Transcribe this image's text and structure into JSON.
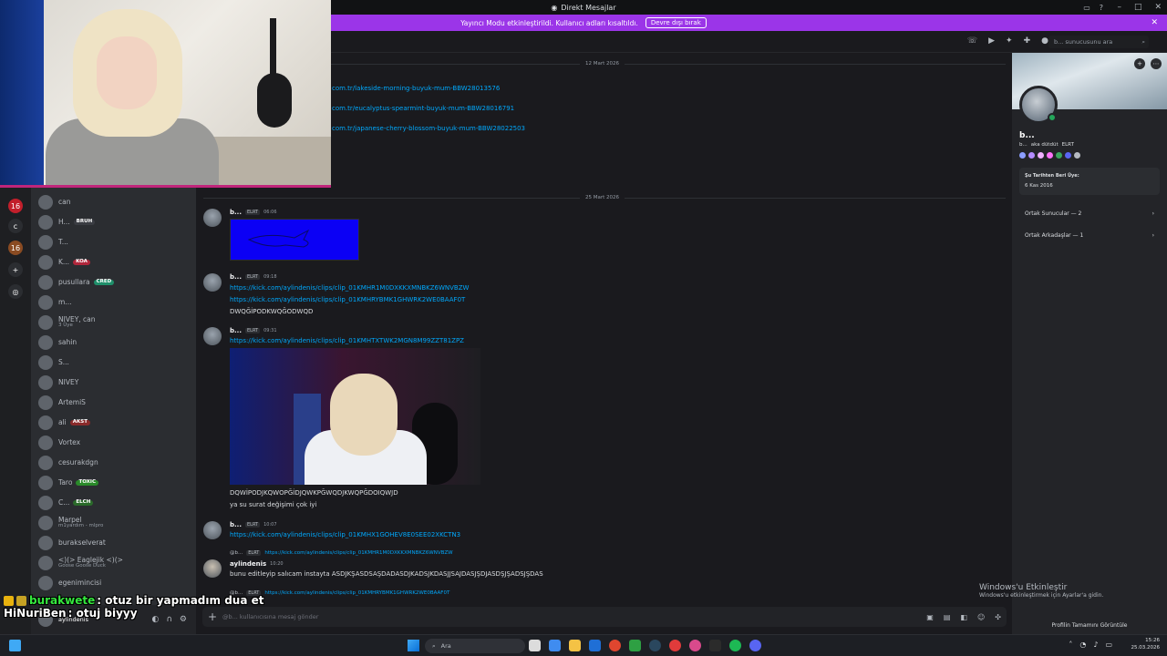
{
  "window": {
    "title": "Direkt Mesajlar"
  },
  "banner": {
    "text": "Yayıncı Modu etkinleştirildi. Kullanıcı adları kısaltıldı.",
    "button": "Devre dışı bırak"
  },
  "header": {
    "search_placeholder": "b... sunucusunu ara"
  },
  "rail": {
    "badge1": "16",
    "badge2": "16"
  },
  "dm_list": [
    {
      "name": "can",
      "sub": "",
      "tag": ""
    },
    {
      "name": "H...",
      "sub": "",
      "tag": "BRUH",
      "tag_color": "#3a3c42"
    },
    {
      "name": "T...",
      "sub": "",
      "tag": ""
    },
    {
      "name": "K...",
      "sub": "",
      "tag": "KOA",
      "tag_color": "#b0263b"
    },
    {
      "name": "pusullara",
      "sub": "",
      "tag": "CRED",
      "tag_color": "#1f8f6a"
    },
    {
      "name": "m...",
      "sub": "",
      "tag": ""
    },
    {
      "name": "NIVEY, can",
      "sub": "3 Üye",
      "tag": ""
    },
    {
      "name": "sahin",
      "sub": "",
      "tag": ""
    },
    {
      "name": "S...",
      "sub": "",
      "tag": ""
    },
    {
      "name": "NIVEY",
      "sub": "",
      "tag": ""
    },
    {
      "name": "ArtemiS",
      "sub": "",
      "tag": ""
    },
    {
      "name": "ali",
      "sub": "",
      "tag": "AKST",
      "tag_color": "#8a2a2a"
    },
    {
      "name": "Vortex",
      "sub": "",
      "tag": ""
    },
    {
      "name": "cesurakdgn",
      "sub": "",
      "tag": ""
    },
    {
      "name": "Taro",
      "sub": "",
      "tag": "TOXIC",
      "tag_color": "#2a8a2a"
    },
    {
      "name": "C...",
      "sub": "",
      "tag": "ELCH",
      "tag_color": "#2a6a2a"
    },
    {
      "name": "Marpel",
      "sub": "m1yardım - mlpro",
      "tag": ""
    },
    {
      "name": "burakselverat",
      "sub": "",
      "tag": ""
    },
    {
      "name": "<)(> Eaglejik <)(>",
      "sub": "Goose Goose Duck",
      "tag": ""
    },
    {
      "name": "egenimincisi",
      "sub": "",
      "tag": ""
    }
  ],
  "user_panel": {
    "name": "aylindenis"
  },
  "messages": {
    "date1": "12 Mart 2026",
    "date2": "25 Mart 2026",
    "top_links": [
      "com.tr/lakeside-morning-buyuk-mum-BBW28013576",
      "com.tr/eucalyptus-spearmint-buyuk-mum-BBW28016791",
      "com.tr/japanese-cherry-blossom-buyuk-mum-BBW28022503"
    ],
    "m1": {
      "author": "b...",
      "clan": "ELRT",
      "time": "06:06"
    },
    "m2": {
      "author": "b...",
      "clan": "ELRT",
      "time": "09:18",
      "link1": "https://kick.com/aylindenis/clips/clip_01KMHR1M0DXKKXMNBKZ6WNVBZW",
      "link2": "https://kick.com/aylindenis/clips/clip_01KMHRYBMK1GHWRK2WE0BAAF0T",
      "text": "DWQĞİPODKWQĞODWQD"
    },
    "m3": {
      "author": "b...",
      "clan": "ELRT",
      "time": "09:31",
      "link": "https://kick.com/aylindenis/clips/clip_01KMHTXTWK2MGN8M99ZZT81ZPZ",
      "text1": "DQWİPODJKQWOPĞİDJQWKPĞWQDJKWQPĞDOIQWJD",
      "text2": "ya su surat değişimi çok iyi"
    },
    "m4": {
      "author": "b...",
      "clan": "ELRT",
      "time": "10:07",
      "link": "https://kick.com/aylindenis/clips/clip_01KMHX1GOHEV8E0SEE02XKCTN3"
    },
    "reply1": {
      "author": "@b...",
      "clan": "ELRT",
      "link": "https://kick.com/aylindenis/clips/clip_01KMHR1M0DXKKXMNBKZ6WNVBZW"
    },
    "m5": {
      "author": "aylindenis",
      "time": "10:20",
      "text": "bunu editleyip salıcam instayta ASDJKŞASDSAŞDADASDJKADSJKDASJJSAJDASJŞDJASDŞJŞADSJŞDAS"
    },
    "reply2": {
      "author": "@b...",
      "clan": "ELRT",
      "link": "https://kick.com/aylindenis/clips/clip_01KMHRYBMK1GHWRK2WE0BAAF0T"
    }
  },
  "composer": {
    "placeholder": "@b... kullanıcısına mesaj gönder"
  },
  "profile": {
    "name": "b...",
    "aka": "aka dütdüt",
    "clan": "ELRT",
    "member_since_title": "Şu Tarihten Beri Üye:",
    "member_since": "6 Kas 2016",
    "mutual_servers": "Ortak Sunucular — 2",
    "mutual_friends": "Ortak Arkadaşlar — 1",
    "full_profile": "Profilin Tamamını Görüntüle"
  },
  "activation": {
    "title": "Windows'u Etkinleştir",
    "sub": "Windows'u etkinleştirmek için Ayarlar'a gidin."
  },
  "overlay": {
    "line1_user": "burakwete",
    "line1_text": ": otuz bir yapmadım dua et",
    "line2_user": "HiNuriBen",
    "line2_text": ": otuj biyyy"
  },
  "taskbar": {
    "search": "Ara",
    "time": "15:26",
    "date": "25.03.2026"
  }
}
